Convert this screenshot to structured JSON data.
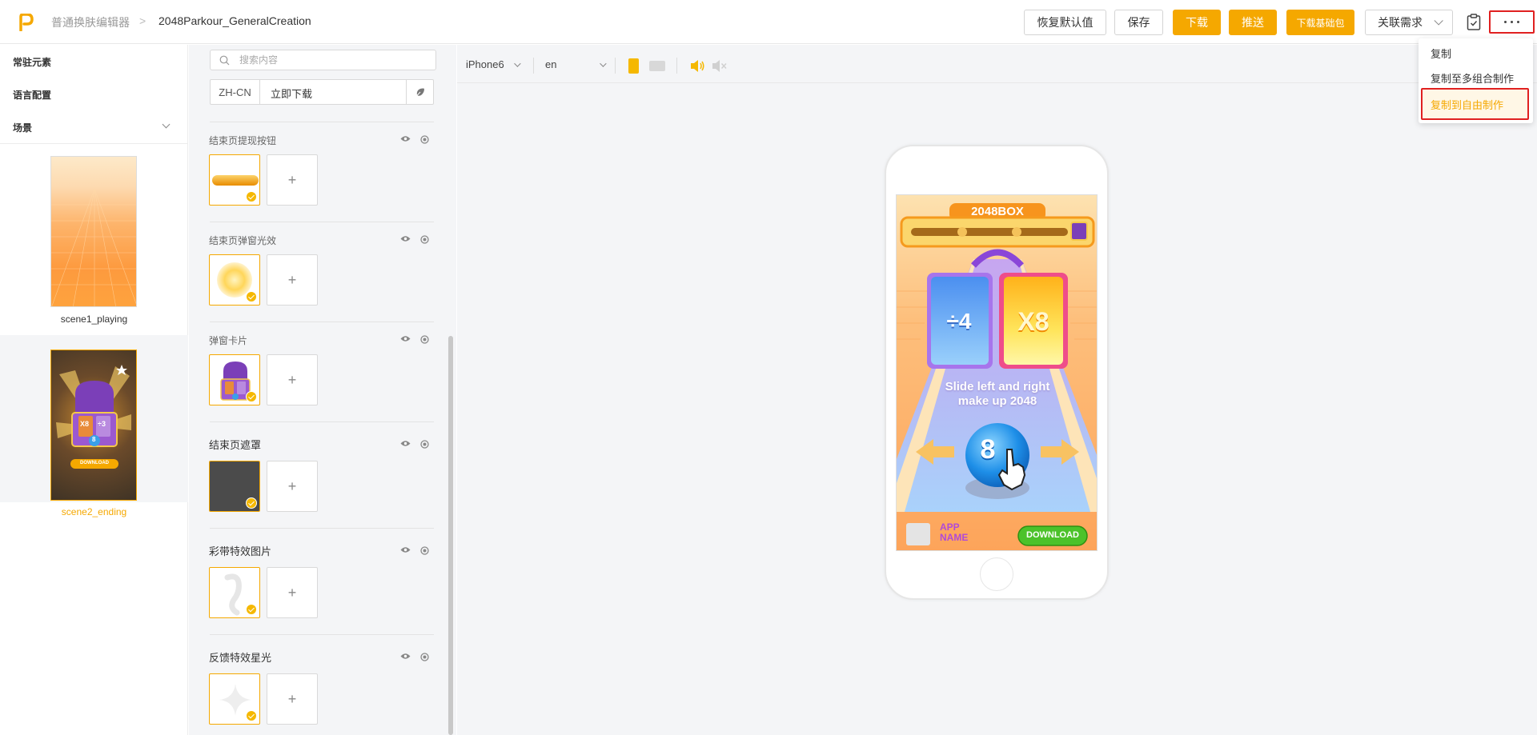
{
  "header": {
    "breadcrumb_root": "普通换肤编辑器",
    "breadcrumb_sep": ">",
    "project_name": "2048Parkour_GeneralCreation",
    "buttons": {
      "restore": "恢复默认值",
      "save": "保存",
      "download": "下载",
      "push": "推送",
      "download_base": "下载基础包",
      "related": "关联需求"
    }
  },
  "more_menu": {
    "items": [
      "复制",
      "复制至多组合制作",
      "复制到自由制作"
    ]
  },
  "sidebar": {
    "items": [
      "常驻元素",
      "语言配置",
      "场景"
    ],
    "scenes": [
      {
        "label": "scene1_playing"
      },
      {
        "label": "scene2_ending"
      }
    ]
  },
  "panel": {
    "search_placeholder": "搜索内容",
    "lang_code": "ZH-CN",
    "lang_value": "立即下载",
    "sections": [
      {
        "title": "结束页提现按钮"
      },
      {
        "title": "结束页弹窗光效"
      },
      {
        "title": "弹窗卡片"
      },
      {
        "title": "结束页遮罩"
      },
      {
        "title": "彩带特效图片"
      },
      {
        "title": "反馈特效星光"
      }
    ],
    "add_label": "+"
  },
  "toolbar": {
    "device": "iPhone6",
    "language": "en"
  },
  "preview": {
    "box_title": "2048BOX",
    "card_left": "÷4",
    "card_right": "X8",
    "hint_line1": "Slide left and right",
    "hint_line2": "make up 2048",
    "ball_number": "8",
    "app_name_line1": "APP",
    "app_name_line2": "NAME",
    "download_label": "DOWNLOAD",
    "thumb_download": "DOWNLOAD",
    "thumb_card1": "X8",
    "thumb_card2": "÷3",
    "thumb_ball": "8"
  },
  "colors": {
    "accent": "#f5a800",
    "highlight_border": "#e02020",
    "panel_bg": "#f4f5f7"
  }
}
